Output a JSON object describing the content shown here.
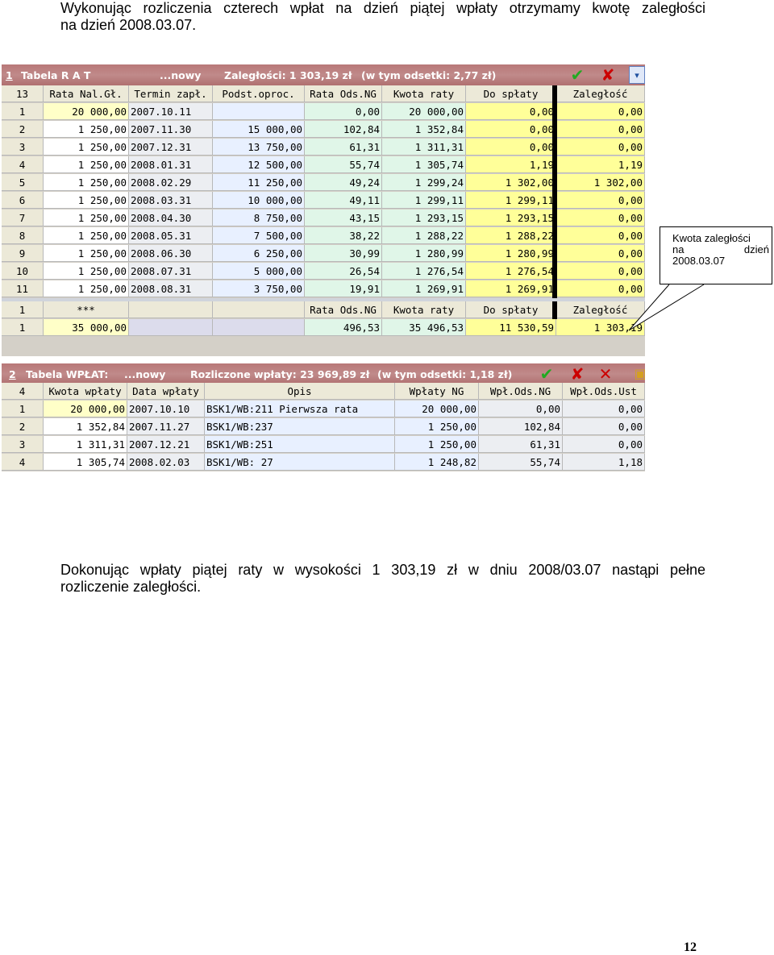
{
  "intro": {
    "line1": "Wykonując rozliczenia czterech wpłat na dzień  piątej wpłaty  otrzymamy kwotę zaległości",
    "line2": "na dzień 2008.03.07."
  },
  "rat_table": {
    "title_index": "1",
    "title": "Tabela R A T",
    "status_new": "...nowy",
    "summary": "Zaległości: 1 303,19 zł",
    "interest_note": "(w tym odsetki: 2,77 zł)",
    "row_count": "13",
    "columns": [
      "Rata Nal.Gł.",
      "Termin zapł.",
      "Podst.oproc.",
      "Rata Ods.NG",
      "Kwota raty",
      "Do spłaty",
      "Zaległość"
    ],
    "rows": [
      [
        "1",
        "20 000,00",
        "2007.10.11",
        "",
        "0,00",
        "20 000,00",
        "0,00",
        "0,00"
      ],
      [
        "2",
        "1 250,00",
        "2007.11.30",
        "15 000,00",
        "102,84",
        "1 352,84",
        "0,00",
        "0,00"
      ],
      [
        "3",
        "1 250,00",
        "2007.12.31",
        "13 750,00",
        "61,31",
        "1 311,31",
        "0,00",
        "0,00"
      ],
      [
        "4",
        "1 250,00",
        "2008.01.31",
        "12 500,00",
        "55,74",
        "1 305,74",
        "1,19",
        "1,19"
      ],
      [
        "5",
        "1 250,00",
        "2008.02.29",
        "11 250,00",
        "49,24",
        "1 299,24",
        "1 302,00",
        "1 302,00"
      ],
      [
        "6",
        "1 250,00",
        "2008.03.31",
        "10 000,00",
        "49,11",
        "1 299,11",
        "1 299,11",
        "0,00"
      ],
      [
        "7",
        "1 250,00",
        "2008.04.30",
        "8 750,00",
        "43,15",
        "1 293,15",
        "1 293,15",
        "0,00"
      ],
      [
        "8",
        "1 250,00",
        "2008.05.31",
        "7 500,00",
        "38,22",
        "1 288,22",
        "1 288,22",
        "0,00"
      ],
      [
        "9",
        "1 250,00",
        "2008.06.30",
        "6 250,00",
        "30,99",
        "1 280,99",
        "1 280,99",
        "0,00"
      ],
      [
        "10",
        "1 250,00",
        "2008.07.31",
        "5 000,00",
        "26,54",
        "1 276,54",
        "1 276,54",
        "0,00"
      ],
      [
        "11",
        "1 250,00",
        "2008.08.31",
        "3 750,00",
        "19,91",
        "1 269,91",
        "1 269,91",
        "0,00"
      ]
    ],
    "summary_header": [
      "1",
      "***",
      "",
      "",
      "Rata Ods.NG",
      "Kwota raty",
      "Do spłaty",
      "Zaległość"
    ],
    "summary_row": [
      "1",
      "35 000,00",
      "",
      "",
      "496,53",
      "35 496,53",
      "11 530,59",
      "1 303,19"
    ]
  },
  "wpl_table": {
    "title_index": "2",
    "title": "Tabela WPŁAT:",
    "status_new": "...nowy",
    "summary": "Rozliczone wpłaty: 23 969,89 zł",
    "interest_note": "(w tym odsetki: 1,18 zł)",
    "row_count": "4",
    "columns": [
      "Kwota wpłaty",
      "Data wpłaty",
      "Opis",
      "Wpłaty NG",
      "Wpł.Ods.NG",
      "Wpł.Ods.Ust"
    ],
    "rows": [
      [
        "1",
        "20 000,00",
        "2007.10.10",
        "BSK1/WB:211 Pierwsza rata",
        "20 000,00",
        "0,00",
        "0,00"
      ],
      [
        "2",
        "1 352,84",
        "2007.11.27",
        "BSK1/WB:237",
        "1 250,00",
        "102,84",
        "0,00"
      ],
      [
        "3",
        "1 311,31",
        "2007.12.21",
        "BSK1/WB:251",
        "1 250,00",
        "61,31",
        "0,00"
      ],
      [
        "4",
        "1 305,74",
        "2008.02.03",
        "BSK1/WB: 27",
        "1 248,82",
        "55,74",
        "1,18"
      ]
    ]
  },
  "annotation": {
    "line1": "Kwota zaległości",
    "line2": "na dzień",
    "line3": "2008.03.07"
  },
  "conclusion": {
    "line1": "Dokonując wpłaty piątej raty w wysokości 1 303,19 zł w dniu 2008/03.07 nastąpi pełne",
    "line2": "rozliczenie zaległości."
  },
  "page_number": "12",
  "icons": {
    "confirm": "check-icon",
    "cancel_all": "cross-check-icon",
    "close": "close-icon",
    "lock": "lock-icon",
    "filter": "filter-icon"
  },
  "colors": {
    "title_bar": "#c08a8a",
    "ok_green": "#22aa22",
    "cancel_red": "#cc0000",
    "zone_white": "#ffffff",
    "zone_gray": "#eceef2",
    "zone_blue": "#e8f0ff",
    "zone_green": "#e0f6e8",
    "zone_yellow": "#ffff99",
    "selected_cell": "#ffffc8"
  }
}
